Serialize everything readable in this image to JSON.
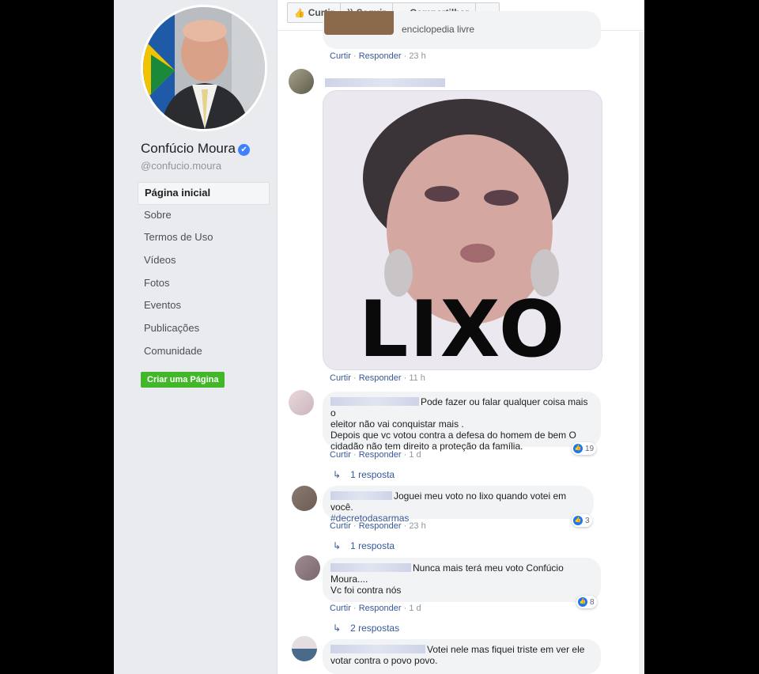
{
  "profile": {
    "name": "Confúcio Moura",
    "username": "@confucio.moura",
    "verified_glyph": "✔"
  },
  "nav": [
    {
      "label": "Página inicial",
      "active": true
    },
    {
      "label": "Sobre"
    },
    {
      "label": "Termos de Uso"
    },
    {
      "label": "Vídeos"
    },
    {
      "label": "Fotos"
    },
    {
      "label": "Eventos"
    },
    {
      "label": "Publicações"
    },
    {
      "label": "Comunidade"
    }
  ],
  "create_page": "Criar uma Página",
  "action_bar": {
    "like": "Curtir",
    "follow": "Seguir",
    "share": "Compartilhar",
    "more": "•••"
  },
  "comments": {
    "c0": {
      "partial_text": "enciclopedia livre",
      "like": "Curtir",
      "reply": "Responder",
      "time": "23 h"
    },
    "c1": {
      "sticker_text": "LIXO",
      "like": "Curtir",
      "reply": "Responder",
      "time": "11 h"
    },
    "c2": {
      "line1": "Pode fazer ou falar qualquer coisa mais o",
      "line2": "eleitor não vai conquistar mais .",
      "line3": "Depois que vc votou contra a defesa do homem de bem O",
      "line4": "cidadão não tem direito a proteção da família.",
      "like": "Curtir",
      "reply": "Responder",
      "time": "1 d",
      "reactions": "19",
      "replies": "1 resposta"
    },
    "c3": {
      "line1": "Joguei meu voto no lixo quando votei em você.",
      "hashtag": "#decretodasarmas",
      "like": "Curtir",
      "reply": "Responder",
      "time": "23 h",
      "reactions": "3",
      "replies": "1 resposta"
    },
    "c4": {
      "line1": "Nunca mais terá meu voto Confúcio",
      "line2": "Moura....",
      "line3": "Vc foi contra nós",
      "like": "Curtir",
      "reply": "Responder",
      "time": "1 d",
      "reactions": "8",
      "replies": "2 respostas"
    },
    "c5": {
      "line1": "Votei nele mas fiquei triste em ver ele",
      "line2": "votar contra o povo povo."
    }
  },
  "separator": "·",
  "colors": {
    "link": "#385898",
    "accent": "#4080ff",
    "create_btn": "#42b72a",
    "bubble": "#f2f3f5"
  }
}
